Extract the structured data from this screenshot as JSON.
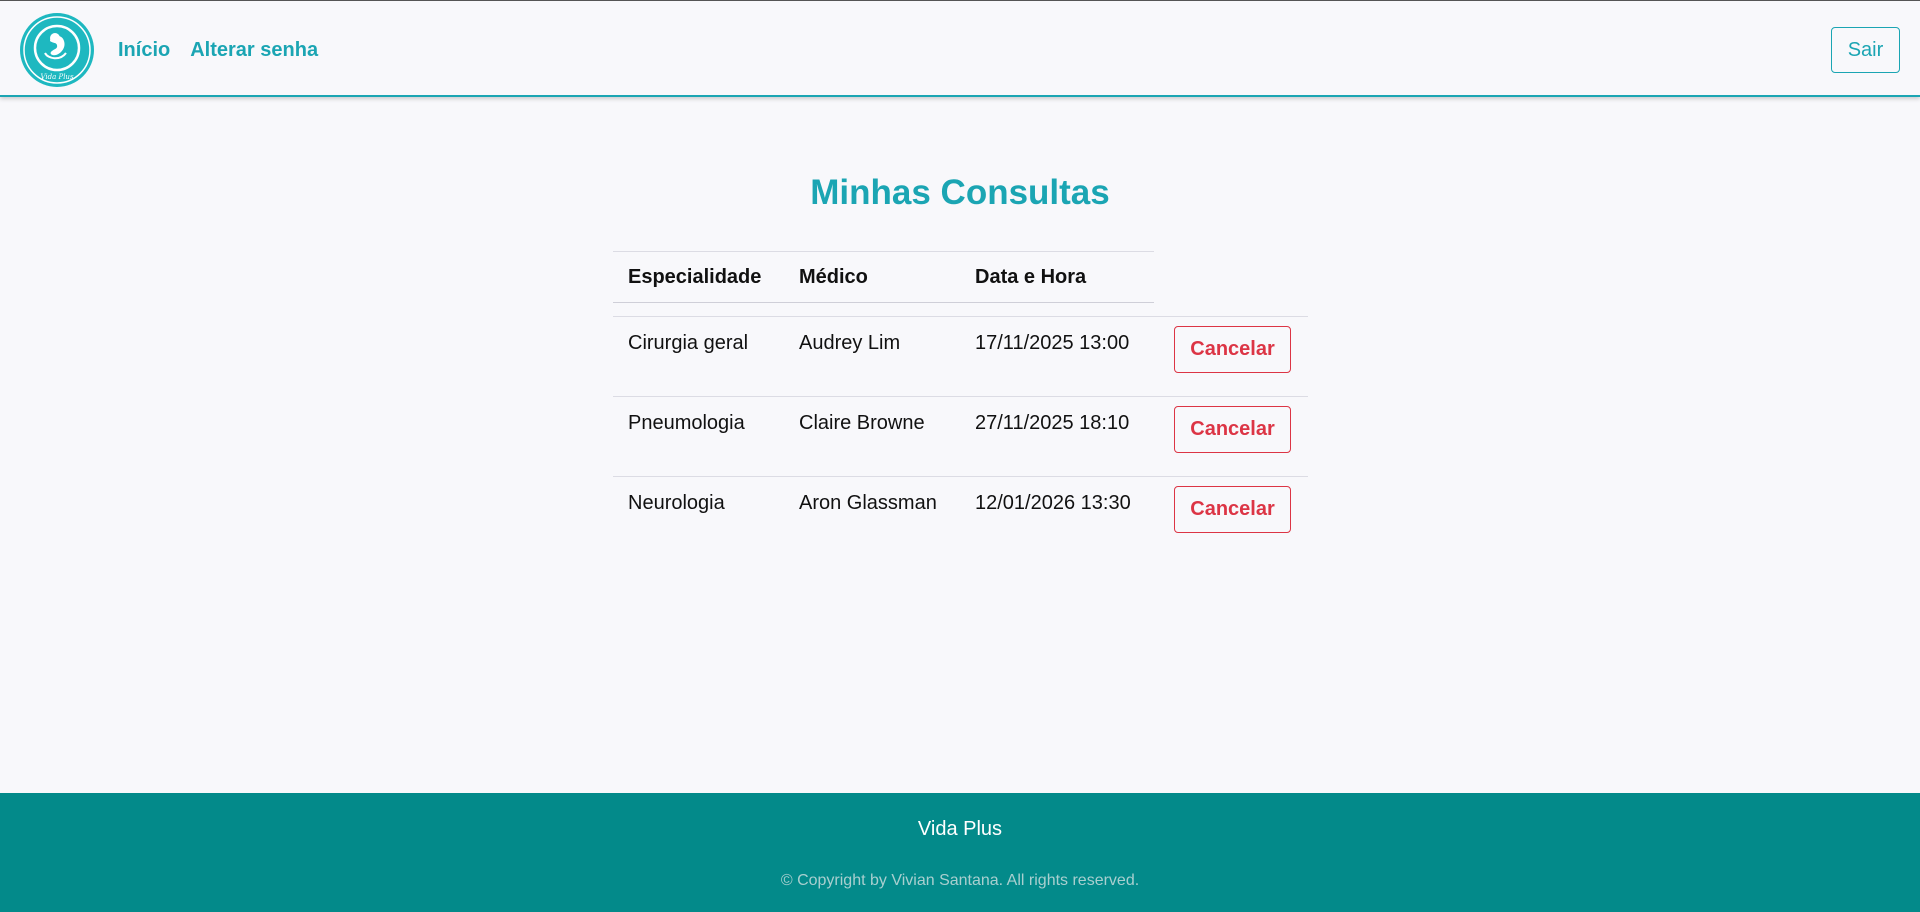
{
  "header": {
    "logo_icon": "baby-fetus-logo-icon",
    "logo_text": "Vida Plus",
    "nav": [
      {
        "label": "Início"
      },
      {
        "label": "Alterar senha"
      }
    ],
    "logout_label": "Sair"
  },
  "main": {
    "title": "Minhas Consultas",
    "table": {
      "columns": [
        "Especialidade",
        "Médico",
        "Data e Hora"
      ],
      "rows": [
        {
          "especialidade": "Cirurgia geral",
          "medico": "Audrey Lim",
          "data_hora": "17/11/2025 13:00",
          "action": "Cancelar"
        },
        {
          "especialidade": "Pneumologia",
          "medico": "Claire Browne",
          "data_hora": "27/11/2025 18:10",
          "action": "Cancelar"
        },
        {
          "especialidade": "Neurologia",
          "medico": "Aron Glassman",
          "data_hora": "12/01/2026 13:30",
          "action": "Cancelar"
        }
      ]
    }
  },
  "footer": {
    "title": "Vida Plus",
    "copyright": "© Copyright by Vivian Santana. All rights reserved."
  },
  "colors": {
    "accent": "#1ba5b3",
    "danger": "#dc3545",
    "footer_bg": "#038a8a",
    "page_bg": "#f8f8fb"
  }
}
